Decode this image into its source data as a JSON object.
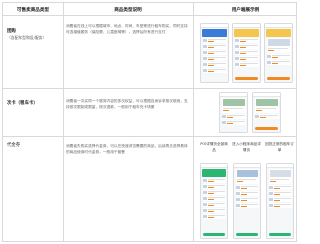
{
  "header": {
    "col1": "可售卖商品类型",
    "col2": "商品类型说明",
    "col3": "用户端展示例"
  },
  "rows": [
    {
      "type_name": "团购",
      "type_note": "（含配车型和设/服务）",
      "description": "消费者在线上可以根据城市、地点、时间、车型等进行租车购买，同时支持可选增值服务（保险费、儿童座椅等），选择后所有进行支付"
    },
    {
      "type_name": "次卡（租车卡）",
      "type_note": "",
      "description": "消费者一次买同一个服务内容的多次权益，可以根据自身诉求按次使用，支持按次限制或限量，按次退款，一般用于租车充卡场景"
    },
    {
      "type_name": "代金券",
      "type_note": "",
      "description": "消费者先购买选择代金券，可以在快速浏览需要的商品，后续再去选择具体的商品使用时代金券，一般用于套餐"
    }
  ],
  "captions": {
    "cap1": "POI详情页全部商品",
    "cap2": "进入小程序商品详情页",
    "cap3": "回抵正常的租车订单"
  },
  "colors": {
    "accent_orange": "#f08a24",
    "accent_green": "#2bb673",
    "grid": "#d9d9d9"
  }
}
